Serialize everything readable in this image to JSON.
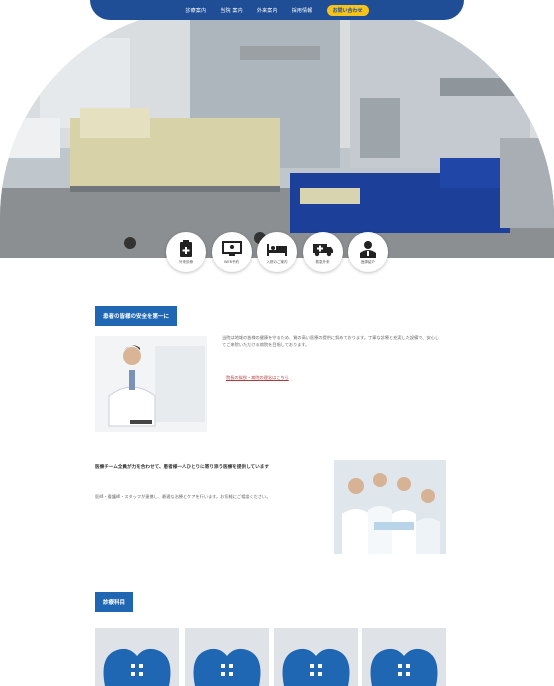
{
  "nav": {
    "items": [
      "診療案内",
      "当院 案内",
      "外来案内",
      "採用情報"
    ],
    "cta": "お問い合わせ"
  },
  "hero": {
    "photo": "hospital-room-photo"
  },
  "quick_links": [
    {
      "icon": "clipboard-icon",
      "label": "外来診療"
    },
    {
      "icon": "monitor-icon",
      "label": "WEB予約"
    },
    {
      "icon": "bed-icon",
      "label": "入院のご案内"
    },
    {
      "icon": "ambulance-icon",
      "label": "救急外来"
    },
    {
      "icon": "doctor-icon",
      "label": "医師紹介"
    }
  ],
  "section1": {
    "badge": "患者の皆様の安全を第一に",
    "body": "当院は地域の皆様の健康を守るため、質の高い医療の提供に努めております。丁寧な診療と充実した設備で、安心してご来院いただける病院を目指しております。",
    "link": "院長の挨拶・病院の理念はこちら"
  },
  "section2": {
    "heading": "医療チーム全員が力を合わせて、患者様一人ひとりに寄り添う医療を提供しています",
    "body": "医師・看護師・スタッフが連携し、最適な治療とケアを行います。お気軽にご相談ください。"
  },
  "section3": {
    "badge": "診療科目"
  },
  "colors": {
    "primary": "#1f66b3",
    "nav": "#1f4e96",
    "cta": "#f6c31a"
  }
}
